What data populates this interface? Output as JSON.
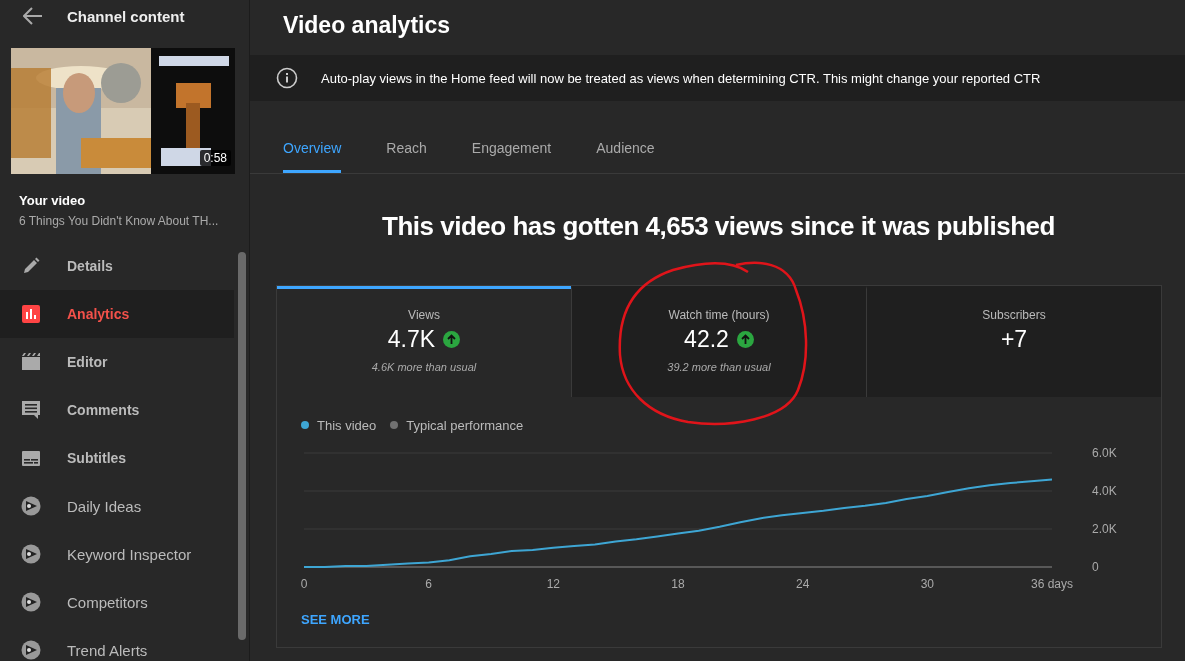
{
  "sidebar": {
    "title": "Channel content",
    "thumbnail": {
      "kind": "picture",
      "duration": "0:58"
    },
    "video_label": "Your video",
    "video_title": "6 Things You Didn't Know About TH...",
    "items": [
      {
        "label": "Details",
        "kind": "details",
        "selected": false
      },
      {
        "label": "Analytics",
        "kind": "analytics",
        "selected": true
      },
      {
        "label": "Editor",
        "kind": "editor",
        "selected": false
      },
      {
        "label": "Comments",
        "kind": "comments",
        "selected": false
      },
      {
        "label": "Subtitles",
        "kind": "subtitles",
        "selected": false
      },
      {
        "label": "Daily Ideas",
        "kind": "extension",
        "selected": false
      },
      {
        "label": "Keyword Inspector",
        "kind": "extension",
        "selected": false
      },
      {
        "label": "Competitors",
        "kind": "extension",
        "selected": false
      },
      {
        "label": "Trend Alerts",
        "kind": "extension",
        "selected": false
      }
    ]
  },
  "page": {
    "title": "Video analytics",
    "notice": "Auto-play views in the Home feed will now be treated as views when determining CTR. This might change your reported CTR",
    "tabs": [
      {
        "label": "Overview",
        "selected": true
      },
      {
        "label": "Reach",
        "selected": false
      },
      {
        "label": "Engagement",
        "selected": false
      },
      {
        "label": "Audience",
        "selected": false
      }
    ],
    "headline": "This video has gotten 4,653 views since it was published",
    "metrics": [
      {
        "label": "Views",
        "value": "4.7K",
        "up": true,
        "note": "4.6K more than usual",
        "selected": true
      },
      {
        "label": "Watch time (hours)",
        "value": "42.2",
        "up": true,
        "note": "39.2 more than usual",
        "selected": false
      },
      {
        "label": "Subscribers",
        "value": "+7",
        "selected": false
      }
    ],
    "chart_data": {
      "type": "line",
      "x": [
        0,
        1,
        2,
        3,
        4,
        5,
        6,
        7,
        8,
        9,
        10,
        11,
        12,
        13,
        14,
        15,
        16,
        17,
        18,
        19,
        20,
        21,
        22,
        23,
        24,
        25,
        26,
        27,
        28,
        29,
        30,
        31,
        32,
        33,
        34,
        35,
        36
      ],
      "series": [
        {
          "name": "This video",
          "color": "#3ea6d4",
          "values": [
            0,
            0,
            60,
            60,
            120,
            180,
            240,
            360,
            570,
            690,
            840,
            900,
            1010,
            1100,
            1190,
            1340,
            1460,
            1610,
            1760,
            1910,
            2120,
            2360,
            2570,
            2720,
            2840,
            2960,
            3100,
            3220,
            3370,
            3580,
            3730,
            3940,
            4150,
            4300,
            4420,
            4510,
            4600
          ]
        },
        {
          "name": "Typical performance",
          "color": "#717171",
          "values": [
            null,
            null,
            null,
            null,
            null,
            null,
            null,
            null,
            null,
            null,
            null,
            null,
            null,
            null,
            null,
            null,
            null,
            null,
            null,
            null,
            null,
            null,
            null,
            null,
            null,
            null,
            null,
            null,
            null,
            null,
            null,
            null,
            null,
            null,
            null,
            null,
            null
          ]
        }
      ],
      "xlim": [
        0,
        36
      ],
      "ylim": [
        0,
        6000
      ],
      "xticks": [
        0,
        6,
        12,
        18,
        24,
        30,
        {
          "value": 36,
          "label": "36 days"
        }
      ],
      "yticks": [
        0,
        {
          "value": 2000,
          "label": "2.0K"
        },
        {
          "value": 4000,
          "label": "4.0K"
        },
        {
          "value": 6000,
          "label": "6.0K"
        }
      ]
    },
    "see_more": "SEE MORE"
  }
}
